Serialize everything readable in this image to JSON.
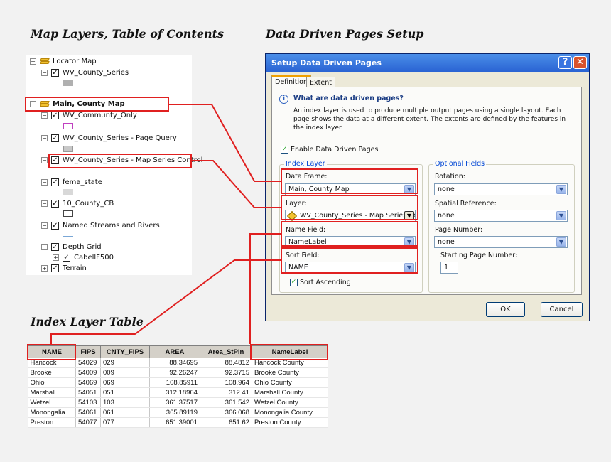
{
  "headings": {
    "toc": "Map Layers, Table of Contents",
    "ddp": "Data Driven Pages Setup",
    "table": "Index Layer Table"
  },
  "toc": {
    "locator_map": "Locator Map",
    "wv_county_series_1": "WV_County_Series",
    "main_county_map": "Main, County Map",
    "wv_community_only": "WV_Communty_Only",
    "page_query": "WV_County_Series - Page Query",
    "map_series_control": "WV_County_Series - Map Series Control",
    "fema_state": "fema_state",
    "county_cb": "10_County_CB",
    "streams": "Named Streams and Rivers",
    "depth_grid": "Depth Grid",
    "cabell": "CabellF500",
    "terrain": "Terrain",
    "expand_minus": "−",
    "expand_plus": "+",
    "check": "✓"
  },
  "dialog": {
    "title": "Setup Data Driven Pages",
    "help_btn": "?",
    "close_btn": "✕",
    "tabs": [
      "Definition",
      "Extent"
    ],
    "info_icon": "i",
    "info_title": "What are data driven pages?",
    "info_text": "An index layer is used to produce multiple output pages using a single layout.  Each page shows the data at a different extent.  The extents are defined by the features in the index layer.",
    "enable_label": "Enable Data Driven Pages",
    "index_layer_group": "Index Layer",
    "optional_fields_group": "Optional Fields",
    "data_frame_label": "Data Frame:",
    "data_frame_value": "Main, County Map",
    "layer_label": "Layer:",
    "layer_value": "WV_County_Series - Map Series Contr",
    "name_field_label": "Name Field:",
    "name_field_value": "NameLabel",
    "sort_field_label": "Sort Field:",
    "sort_field_value": "NAME",
    "sort_ascending": "Sort Ascending",
    "rotation_label": "Rotation:",
    "rotation_value": "none",
    "spatial_ref_label": "Spatial Reference:",
    "spatial_ref_value": "none",
    "page_number_label": "Page Number:",
    "page_number_value": "none",
    "starting_page_label": "Starting Page Number:",
    "starting_page_value": "1",
    "ok": "OK",
    "cancel": "Cancel",
    "dropdown_arrow": "▼"
  },
  "table": {
    "columns": [
      "NAME",
      "FIPS",
      "CNTY_FIPS",
      "AREA",
      "Area_StPln",
      "NameLabel"
    ],
    "rows": [
      [
        "Hancock",
        "54029",
        "029",
        "88.34695",
        "88.4812",
        "Hancock County"
      ],
      [
        "Brooke",
        "54009",
        "009",
        "92.26247",
        "92.3715",
        "Brooke County"
      ],
      [
        "Ohio",
        "54069",
        "069",
        "108.85911",
        "108.964",
        "Ohio County"
      ],
      [
        "Marshall",
        "54051",
        "051",
        "312.18964",
        "312.41",
        "Marshall County"
      ],
      [
        "Wetzel",
        "54103",
        "103",
        "361.37517",
        "361.542",
        "Wetzel County"
      ],
      [
        "Monongalia",
        "54061",
        "061",
        "365.89119",
        "366.068",
        "Monongalia County"
      ],
      [
        "Preston",
        "54077",
        "077",
        "651.39001",
        "651.62",
        "Preston County"
      ]
    ]
  },
  "colors": {
    "highlight": "#e02020",
    "titlebar": "#2a63d3",
    "dialog_bg": "#ece9d8"
  }
}
